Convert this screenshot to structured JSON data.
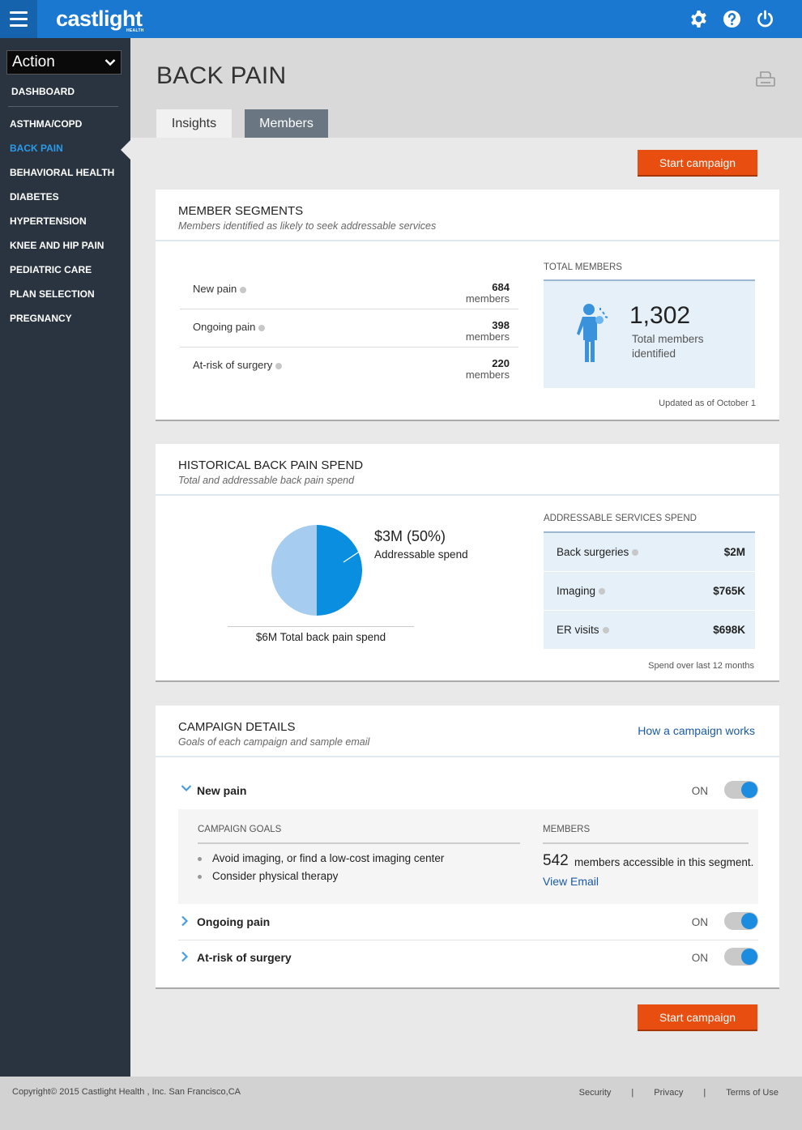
{
  "app": {
    "logo": "castlight",
    "logo_sub": "HEALTH"
  },
  "icons": {
    "menu": "hamburger-icon",
    "settings": "gear-icon",
    "help": "question-icon",
    "power": "power-icon",
    "print": "print-icon"
  },
  "colors": {
    "brand": "#1b78d0",
    "accent": "#e84e0f",
    "sidebar": "#2a3340",
    "active": "#2a9be8",
    "pie_addressable": "#0a8fe0",
    "pie_other": "#a6cdf0"
  },
  "sidebar": {
    "select_value": "Action",
    "dashboard": "DASHBOARD",
    "items": [
      {
        "label": "ASTHMA/COPD",
        "active": false
      },
      {
        "label": "BACK PAIN",
        "active": true
      },
      {
        "label": "BEHAVIORAL HEALTH",
        "active": false
      },
      {
        "label": "DIABETES",
        "active": false
      },
      {
        "label": "HYPERTENSION",
        "active": false
      },
      {
        "label": "KNEE AND HIP PAIN",
        "active": false
      },
      {
        "label": "PEDIATRIC CARE",
        "active": false
      },
      {
        "label": "PLAN SELECTION",
        "active": false
      },
      {
        "label": "PREGNANCY",
        "active": false
      }
    ]
  },
  "header": {
    "title": "BACK PAIN",
    "tabs": [
      "Insights",
      "Members"
    ],
    "active_tab": "Insights"
  },
  "start_campaign": "Start campaign",
  "segments": {
    "title": "MEMBER SEGMENTS",
    "subtitle": "Members identified as likely to seek addressable services",
    "rows": [
      {
        "label": "New pain",
        "count": "684",
        "unit": "members"
      },
      {
        "label": "Ongoing pain",
        "count": "398",
        "unit": "members"
      },
      {
        "label": "At-risk of surgery",
        "count": "220",
        "unit": "members"
      }
    ],
    "total_label": "TOTAL MEMBERS",
    "total_value": "1,302",
    "total_text": "Total members identified",
    "updated": "Updated as of October 1"
  },
  "spend": {
    "title": "HISTORICAL BACK PAIN SPEND",
    "subtitle": "Total and addressable back pain spend",
    "pie_amount": "$3M (50%)",
    "pie_sub": "Addressable spend",
    "pie_total": "$6M Total back pain spend",
    "addressable_label": "ADDRESSABLE SERVICES SPEND",
    "services": [
      {
        "name": "Back surgeries",
        "value": "$2M"
      },
      {
        "name": "Imaging",
        "value": "$765K"
      },
      {
        "name": "ER visits",
        "value": "$698K"
      }
    ],
    "note": "Spend over last 12 months"
  },
  "chart_data": {
    "type": "pie",
    "slices": [
      {
        "label": "Addressable spend",
        "value": 50
      },
      {
        "label": "",
        "value": 50
      }
    ]
  },
  "campaign": {
    "title": "CAMPAIGN DETAILS",
    "subtitle": "Goals of each campaign and sample email",
    "link": "How a campaign works",
    "rows": [
      {
        "name": "New pain",
        "state": "ON",
        "expanded": true
      },
      {
        "name": "Ongoing pain",
        "state": "ON",
        "expanded": false
      },
      {
        "name": "At-risk of surgery",
        "state": "ON",
        "expanded": false
      }
    ],
    "goals_label": "CAMPAIGN GOALS",
    "goals": [
      "Avoid imaging, or find a low-cost imaging center",
      "Consider physical therapy"
    ],
    "members_label": "MEMBERS",
    "members_count": "542",
    "members_text": "members accessible in this segment.",
    "view_email": "View Email"
  },
  "footer": {
    "copyright": "Copyright© 2015  Castlight Health , Inc. San Francisco,CA",
    "links": [
      "Security",
      "Privacy",
      "Terms of Use"
    ],
    "separator": "|"
  }
}
